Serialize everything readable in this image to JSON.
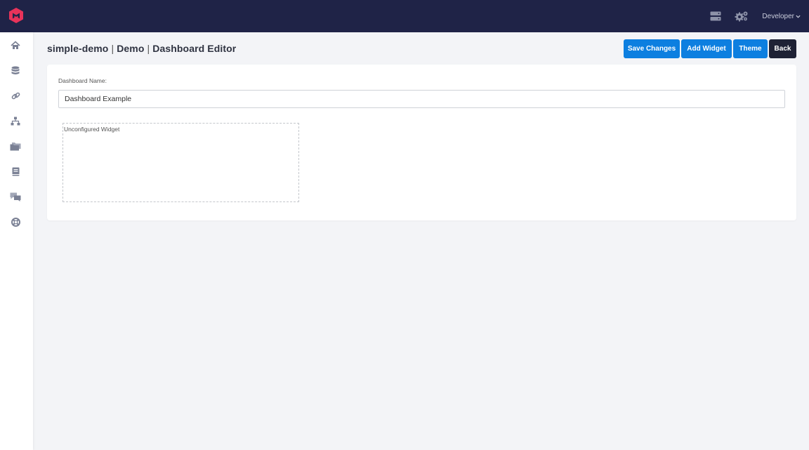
{
  "header": {
    "brand_logo": "brand-logo",
    "icons": [
      "servers-icon",
      "gear-icon"
    ],
    "user_menu_label": "Developer",
    "colors": {
      "background": "#1f2347",
      "accent": "#e8335a"
    }
  },
  "sidebar": {
    "items": [
      {
        "name": "home",
        "icon": "home-icon"
      },
      {
        "name": "database",
        "icon": "database-icon"
      },
      {
        "name": "connections",
        "icon": "link-icon"
      },
      {
        "name": "network",
        "icon": "sitemap-icon"
      },
      {
        "name": "folders",
        "icon": "folder-icon"
      },
      {
        "name": "docs",
        "icon": "book-icon"
      },
      {
        "name": "messages",
        "icon": "chat-icon"
      },
      {
        "name": "support",
        "icon": "lifebuoy-icon"
      }
    ]
  },
  "page": {
    "title_project": "simple-demo",
    "title_separator": "|",
    "title_app": "Demo",
    "title_view": "Dashboard Editor"
  },
  "toolbar": {
    "save_label": "Save Changes",
    "add_widget_label": "Add Widget",
    "theme_label": "Theme",
    "back_label": "Back",
    "colors": {
      "primary": "#0d7fe0",
      "dark": "#1f2235"
    }
  },
  "form": {
    "name_label": "Dashboard Name:",
    "name_value": "Dashboard Example"
  },
  "widgets": [
    {
      "title": "Unconfigured Widget"
    }
  ]
}
